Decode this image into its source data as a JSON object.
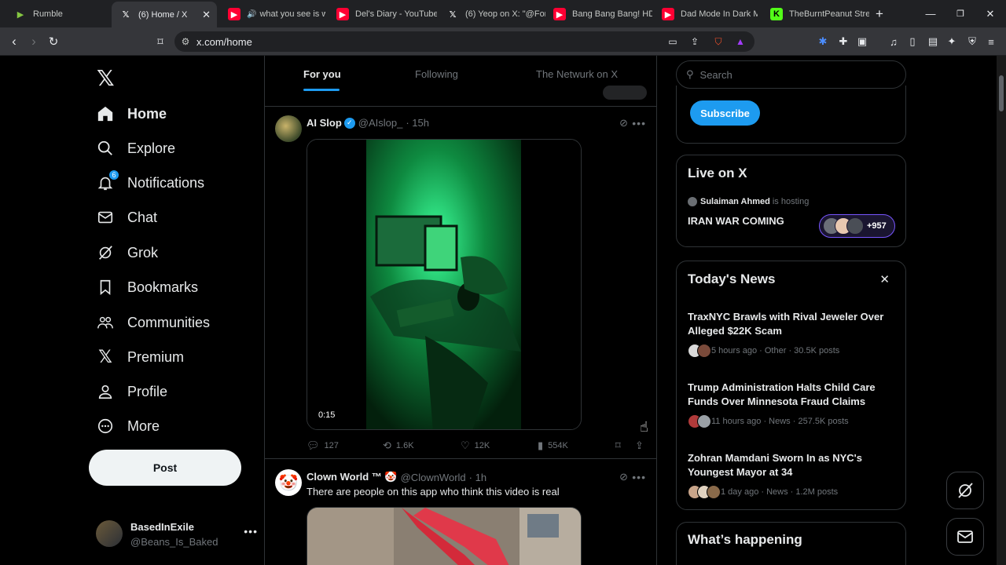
{
  "browser": {
    "tabs": [
      {
        "title": "Rumble",
        "icon": "rumble-icon"
      },
      {
        "title": "(6) Home / X",
        "icon": "x-icon",
        "active": true
      },
      {
        "title": "what you see is w",
        "icon": "youtube-icon",
        "audio": true
      },
      {
        "title": "Del's Diary - YouTube",
        "icon": "youtube-icon"
      },
      {
        "title": "(6) Yeop on X: \"@Fors",
        "icon": "x-icon"
      },
      {
        "title": "Bang Bang Bang! HD",
        "icon": "youtube-icon"
      },
      {
        "title": "Dad Mode In Dark M",
        "icon": "youtube-icon"
      },
      {
        "title": "TheBurntPeanut Strea",
        "icon": "kick-icon"
      }
    ],
    "new_tab": "+",
    "url": "x.com/home"
  },
  "nav": {
    "items": [
      {
        "label": "Home",
        "icon": "home-icon",
        "bold": true
      },
      {
        "label": "Explore",
        "icon": "search-icon"
      },
      {
        "label": "Notifications",
        "icon": "bell-icon",
        "badge": "6"
      },
      {
        "label": "Chat",
        "icon": "mail-icon"
      },
      {
        "label": "Grok",
        "icon": "grok-icon"
      },
      {
        "label": "Bookmarks",
        "icon": "bookmark-icon"
      },
      {
        "label": "Communities",
        "icon": "people-icon"
      },
      {
        "label": "Premium",
        "icon": "x-icon"
      },
      {
        "label": "Profile",
        "icon": "person-icon"
      },
      {
        "label": "More",
        "icon": "more-circle-icon"
      }
    ],
    "post_label": "Post",
    "account": {
      "name": "BasedInExile",
      "handle": "@Beans_Is_Baked"
    }
  },
  "timeline": {
    "tabs": [
      "For you",
      "Following",
      "The Netwurk on X"
    ],
    "posts": [
      {
        "name": "AI Slop",
        "verified": true,
        "handle": "@AIslop_",
        "time": "· 15h",
        "video_time": "0:15",
        "replies": "127",
        "reposts": "1.6K",
        "likes": "12K",
        "views": "554K"
      },
      {
        "name": "Clown World ™ 🤡",
        "handle": "@ClownWorld",
        "time": "· 1h",
        "text": "There are people on this app who think this video is real"
      }
    ]
  },
  "sidebar": {
    "search_placeholder": "Search",
    "subscribe_label": "Subscribe",
    "live": {
      "title": "Live on X",
      "host": "Sulaiman Ahmed",
      "host_suffix": "is hosting",
      "space_title": "IRAN WAR COMING",
      "listener_count": "+957"
    },
    "news": {
      "title": "Today's News",
      "items": [
        {
          "headline": "TraxNYC Brawls with Rival Jeweler Over Alleged $22K Scam",
          "meta": "5 hours ago · Other · 30.5K posts"
        },
        {
          "headline": "Trump Administration Halts Child Care Funds Over Minnesota Fraud Claims",
          "meta": "11 hours ago · News · 257.5K posts"
        },
        {
          "headline": "Zohran Mamdani Sworn In as NYC's Youngest Mayor at 34",
          "meta": "1 day ago · News · 1.2M posts"
        }
      ]
    },
    "happening_title": "What’s happening"
  },
  "colors": {
    "accent": "#1d9bf0",
    "background": "#000000",
    "text": "#e7e9ea",
    "muted": "#71767b",
    "border": "#2f3336",
    "space_ring": "#7856ff"
  }
}
